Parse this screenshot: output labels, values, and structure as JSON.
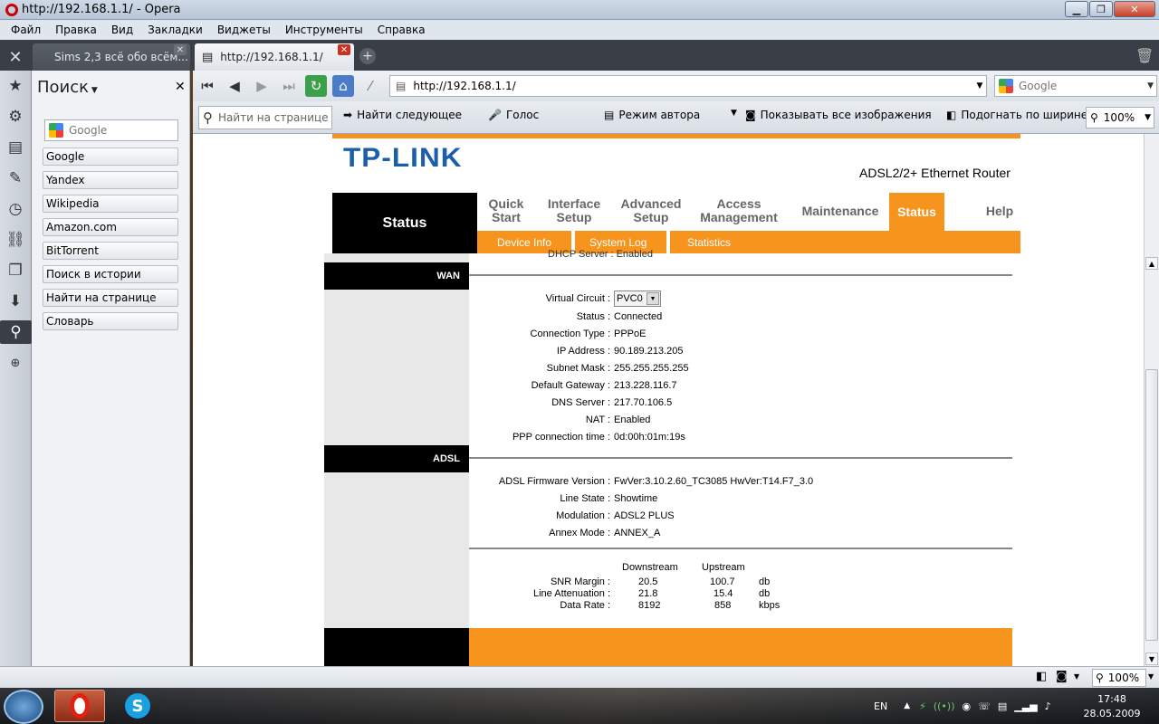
{
  "window": {
    "title": "http://192.168.1.1/ - Opera"
  },
  "menu": [
    "Файл",
    "Правка",
    "Вид",
    "Закладки",
    "Виджеты",
    "Инструменты",
    "Справка"
  ],
  "tabs": [
    {
      "label": "Sims 2,3 всё обо всём..."
    },
    {
      "label": "http://192.168.1.1/"
    }
  ],
  "panel": {
    "title": "Поиск",
    "search_placeholder": "Google",
    "items": [
      "Google",
      "Yandex",
      "Wikipedia",
      "Amazon.com",
      "BitTorrent",
      "Поиск в истории",
      "Найти на странице",
      "Словарь"
    ]
  },
  "navbar": {
    "address": "http://192.168.1.1/",
    "search_engine": "Google"
  },
  "findbar": {
    "find_placeholder": "Найти на странице",
    "find_next": "Найти следующее",
    "voice": "Голос",
    "author_mode": "Режим автора",
    "show_images": "Показывать все изображения",
    "fit_width": "Подогнать по ширине",
    "zoom": "100%"
  },
  "router": {
    "logo": "TP-LINK",
    "model": "ADSL2/2+ Ethernet Router",
    "current_section": "Status",
    "nav": [
      "Quick Start",
      "Interface Setup",
      "Advanced Setup",
      "Access Management",
      "Maintenance",
      "Status",
      "Help"
    ],
    "subnav": [
      "Device Info",
      "System Log",
      "Statistics"
    ],
    "cut_line": "DHCP Server : Enabled",
    "wan": {
      "heading": "WAN",
      "fields": [
        {
          "label": "Virtual Circuit :",
          "value": "PVC0"
        },
        {
          "label": "Status :",
          "value": "Connected"
        },
        {
          "label": "Connection Type :",
          "value": "PPPoE"
        },
        {
          "label": "IP Address :",
          "value": "90.189.213.205"
        },
        {
          "label": "Subnet Mask :",
          "value": "255.255.255.255"
        },
        {
          "label": "Default Gateway :",
          "value": "213.228.116.7"
        },
        {
          "label": "DNS Server :",
          "value": "217.70.106.5"
        },
        {
          "label": "NAT :",
          "value": "Enabled"
        },
        {
          "label": "PPP connection time :",
          "value": "0d:00h:01m:19s"
        }
      ]
    },
    "adsl": {
      "heading": "ADSL",
      "fields": [
        {
          "label": "ADSL Firmware Version :",
          "value": "FwVer:3.10.2.60_TC3085 HwVer:T14.F7_3.0"
        },
        {
          "label": "Line State :",
          "value": "Showtime"
        },
        {
          "label": "Modulation :",
          "value": "ADSL2 PLUS"
        },
        {
          "label": "Annex Mode :",
          "value": "ANNEX_A"
        }
      ],
      "stats_headers": [
        "Downstream",
        "Upstream"
      ],
      "stats": [
        {
          "label": "SNR Margin :",
          "down": "20.5",
          "up": "100.7",
          "unit": "db"
        },
        {
          "label": "Line Attenuation :",
          "down": "21.8",
          "up": "15.4",
          "unit": "db"
        },
        {
          "label": "Data Rate :",
          "down": "8192",
          "up": "858",
          "unit": "kbps"
        }
      ]
    }
  },
  "statusbar": {
    "zoom": "100%"
  },
  "taskbar": {
    "lang": "EN",
    "time": "17:48",
    "date": "28.05.2009"
  }
}
